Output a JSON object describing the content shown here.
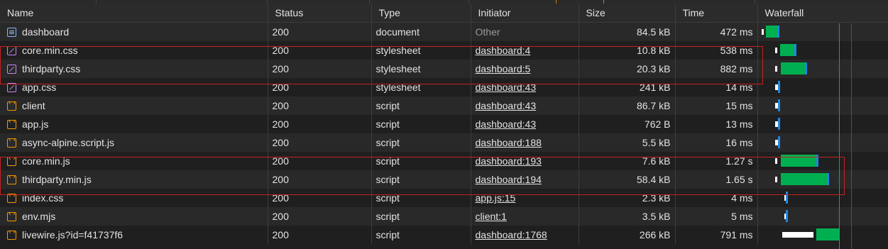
{
  "columns": {
    "name": "Name",
    "status": "Status",
    "type": "Type",
    "initiator": "Initiator",
    "size": "Size",
    "time": "Time",
    "waterfall": "Waterfall"
  },
  "colors": {
    "ttfb": "#00b050",
    "download": "#1e88e5",
    "waiting": "#ffffff",
    "highlight": "#c5221f",
    "dom_line": "#1e88e5",
    "load_line": "#c5221f"
  },
  "rows": [
    {
      "name": "dashboard",
      "icon": "document-icon",
      "status": "200",
      "type": "document",
      "initiator": "Other",
      "initiator_link": false,
      "size": "84.5 kB",
      "time": "472 ms"
    },
    {
      "name": "core.min.css",
      "icon": "stylesheet-icon",
      "status": "200",
      "type": "stylesheet",
      "initiator": "dashboard:4",
      "initiator_link": true,
      "size": "10.8 kB",
      "time": "538 ms"
    },
    {
      "name": "thirdparty.css",
      "icon": "stylesheet-icon",
      "status": "200",
      "type": "stylesheet",
      "initiator": "dashboard:5",
      "initiator_link": true,
      "size": "20.3 kB",
      "time": "882 ms"
    },
    {
      "name": "app.css",
      "icon": "stylesheet-icon",
      "status": "200",
      "type": "stylesheet",
      "initiator": "dashboard:43",
      "initiator_link": true,
      "size": "241 kB",
      "time": "14 ms"
    },
    {
      "name": "client",
      "icon": "script-icon",
      "status": "200",
      "type": "script",
      "initiator": "dashboard:43",
      "initiator_link": true,
      "size": "86.7 kB",
      "time": "15 ms"
    },
    {
      "name": "app.js",
      "icon": "script-icon",
      "status": "200",
      "type": "script",
      "initiator": "dashboard:43",
      "initiator_link": true,
      "size": "762 B",
      "time": "13 ms"
    },
    {
      "name": "async-alpine.script.js",
      "icon": "script-icon",
      "status": "200",
      "type": "script",
      "initiator": "dashboard:188",
      "initiator_link": true,
      "size": "5.5 kB",
      "time": "16 ms"
    },
    {
      "name": "core.min.js",
      "icon": "script-icon",
      "status": "200",
      "type": "script",
      "initiator": "dashboard:193",
      "initiator_link": true,
      "size": "7.6 kB",
      "time": "1.27 s"
    },
    {
      "name": "thirdparty.min.js",
      "icon": "script-icon",
      "status": "200",
      "type": "script",
      "initiator": "dashboard:194",
      "initiator_link": true,
      "size": "58.4 kB",
      "time": "1.65 s"
    },
    {
      "name": "index.css",
      "icon": "script-icon",
      "status": "200",
      "type": "script",
      "initiator": "app.js:15",
      "initiator_link": true,
      "size": "2.3 kB",
      "time": "4 ms"
    },
    {
      "name": "env.mjs",
      "icon": "script-icon",
      "status": "200",
      "type": "script",
      "initiator": "client:1",
      "initiator_link": true,
      "size": "3.5 kB",
      "time": "5 ms"
    },
    {
      "name": "livewire.js?id=f41737f6",
      "icon": "script-icon",
      "status": "200",
      "type": "script",
      "initiator": "dashboard:1768",
      "initiator_link": true,
      "size": "266 kB",
      "time": "791 ms"
    }
  ],
  "highlight_groups": [
    [
      "core.min.css",
      "thirdparty.css"
    ],
    [
      "core.min.js",
      "thirdparty.min.js"
    ]
  ]
}
